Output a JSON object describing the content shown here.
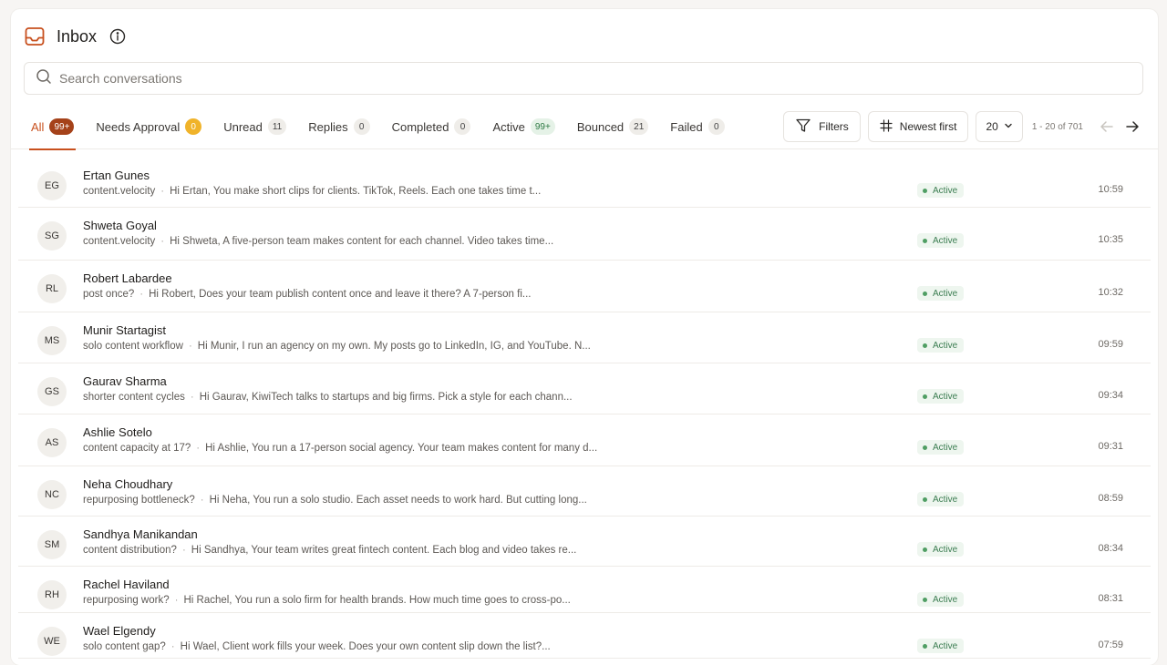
{
  "header": {
    "title": "Inbox"
  },
  "search": {
    "placeholder": "Search conversations"
  },
  "tabs": [
    {
      "label": "All",
      "count": "99+",
      "style": "orange",
      "active": true
    },
    {
      "label": "Needs Approval",
      "count": "0",
      "style": "yellow"
    },
    {
      "label": "Unread",
      "count": "11",
      "style": "gray"
    },
    {
      "label": "Replies",
      "count": "0",
      "style": "gray"
    },
    {
      "label": "Completed",
      "count": "0",
      "style": "gray"
    },
    {
      "label": "Active",
      "count": "99+",
      "style": "green"
    },
    {
      "label": "Bounced",
      "count": "21",
      "style": "gray"
    },
    {
      "label": "Failed",
      "count": "0",
      "style": "gray"
    }
  ],
  "controls": {
    "filters_label": "Filters",
    "sort_label": "Newest first",
    "per_page": "20",
    "range": "1 - 20 of 701"
  },
  "colors": {
    "accent": "#c8501e",
    "active_status": "#3b7d51"
  },
  "rows": [
    {
      "initials": "EG",
      "name": "Ertan Gunes",
      "subject": "content.velocity",
      "preview": "Hi Ertan, You make short clips for clients. TikTok, Reels. Each one takes time t...",
      "status": "Active",
      "time": "10:59"
    },
    {
      "initials": "SG",
      "name": "Shweta Goyal",
      "subject": "content.velocity",
      "preview": "Hi Shweta, A five-person team makes content for each channel. Video takes time...",
      "status": "Active",
      "time": "10:35"
    },
    {
      "initials": "RL",
      "name": "Robert Labardee",
      "subject": "post once?",
      "preview": "Hi Robert, Does your team publish content once and leave it there? A 7-person fi...",
      "status": "Active",
      "time": "10:32"
    },
    {
      "initials": "MS",
      "name": "Munir Startagist",
      "subject": "solo content workflow",
      "preview": "Hi Munir, I run an agency on my own. My posts go to LinkedIn, IG, and YouTube. N...",
      "status": "Active",
      "time": "09:59"
    },
    {
      "initials": "GS",
      "name": "Gaurav Sharma",
      "subject": "shorter content cycles",
      "preview": "Hi Gaurav, KiwiTech talks to startups and big firms. Pick a style for each chann...",
      "status": "Active",
      "time": "09:34"
    },
    {
      "initials": "AS",
      "name": "Ashlie Sotelo",
      "subject": "content capacity at 17?",
      "preview": "Hi Ashlie, You run a 17-person social agency. Your team makes content for many d...",
      "status": "Active",
      "time": "09:31"
    },
    {
      "initials": "NC",
      "name": "Neha Choudhary",
      "subject": "repurposing bottleneck?",
      "preview": "Hi Neha, You run a solo studio. Each asset needs to work hard. But cutting long...",
      "status": "Active",
      "time": "08:59"
    },
    {
      "initials": "SM",
      "name": "Sandhya Manikandan",
      "subject": "content distribution?",
      "preview": "Hi Sandhya, Your team writes great fintech content. Each blog and video takes re...",
      "status": "Active",
      "time": "08:34"
    },
    {
      "initials": "RH",
      "name": "Rachel Haviland",
      "subject": "repurposing work?",
      "preview": "Hi Rachel, You run a solo firm for health brands. How much time goes to cross-po...",
      "status": "Active",
      "time": "08:31"
    },
    {
      "initials": "WE",
      "name": "Wael Elgendy",
      "subject": "solo content gap?",
      "preview": "Hi Wael, Client work fills your week. Does your own content slip down the list?...",
      "status": "Active",
      "time": "07:59"
    }
  ]
}
